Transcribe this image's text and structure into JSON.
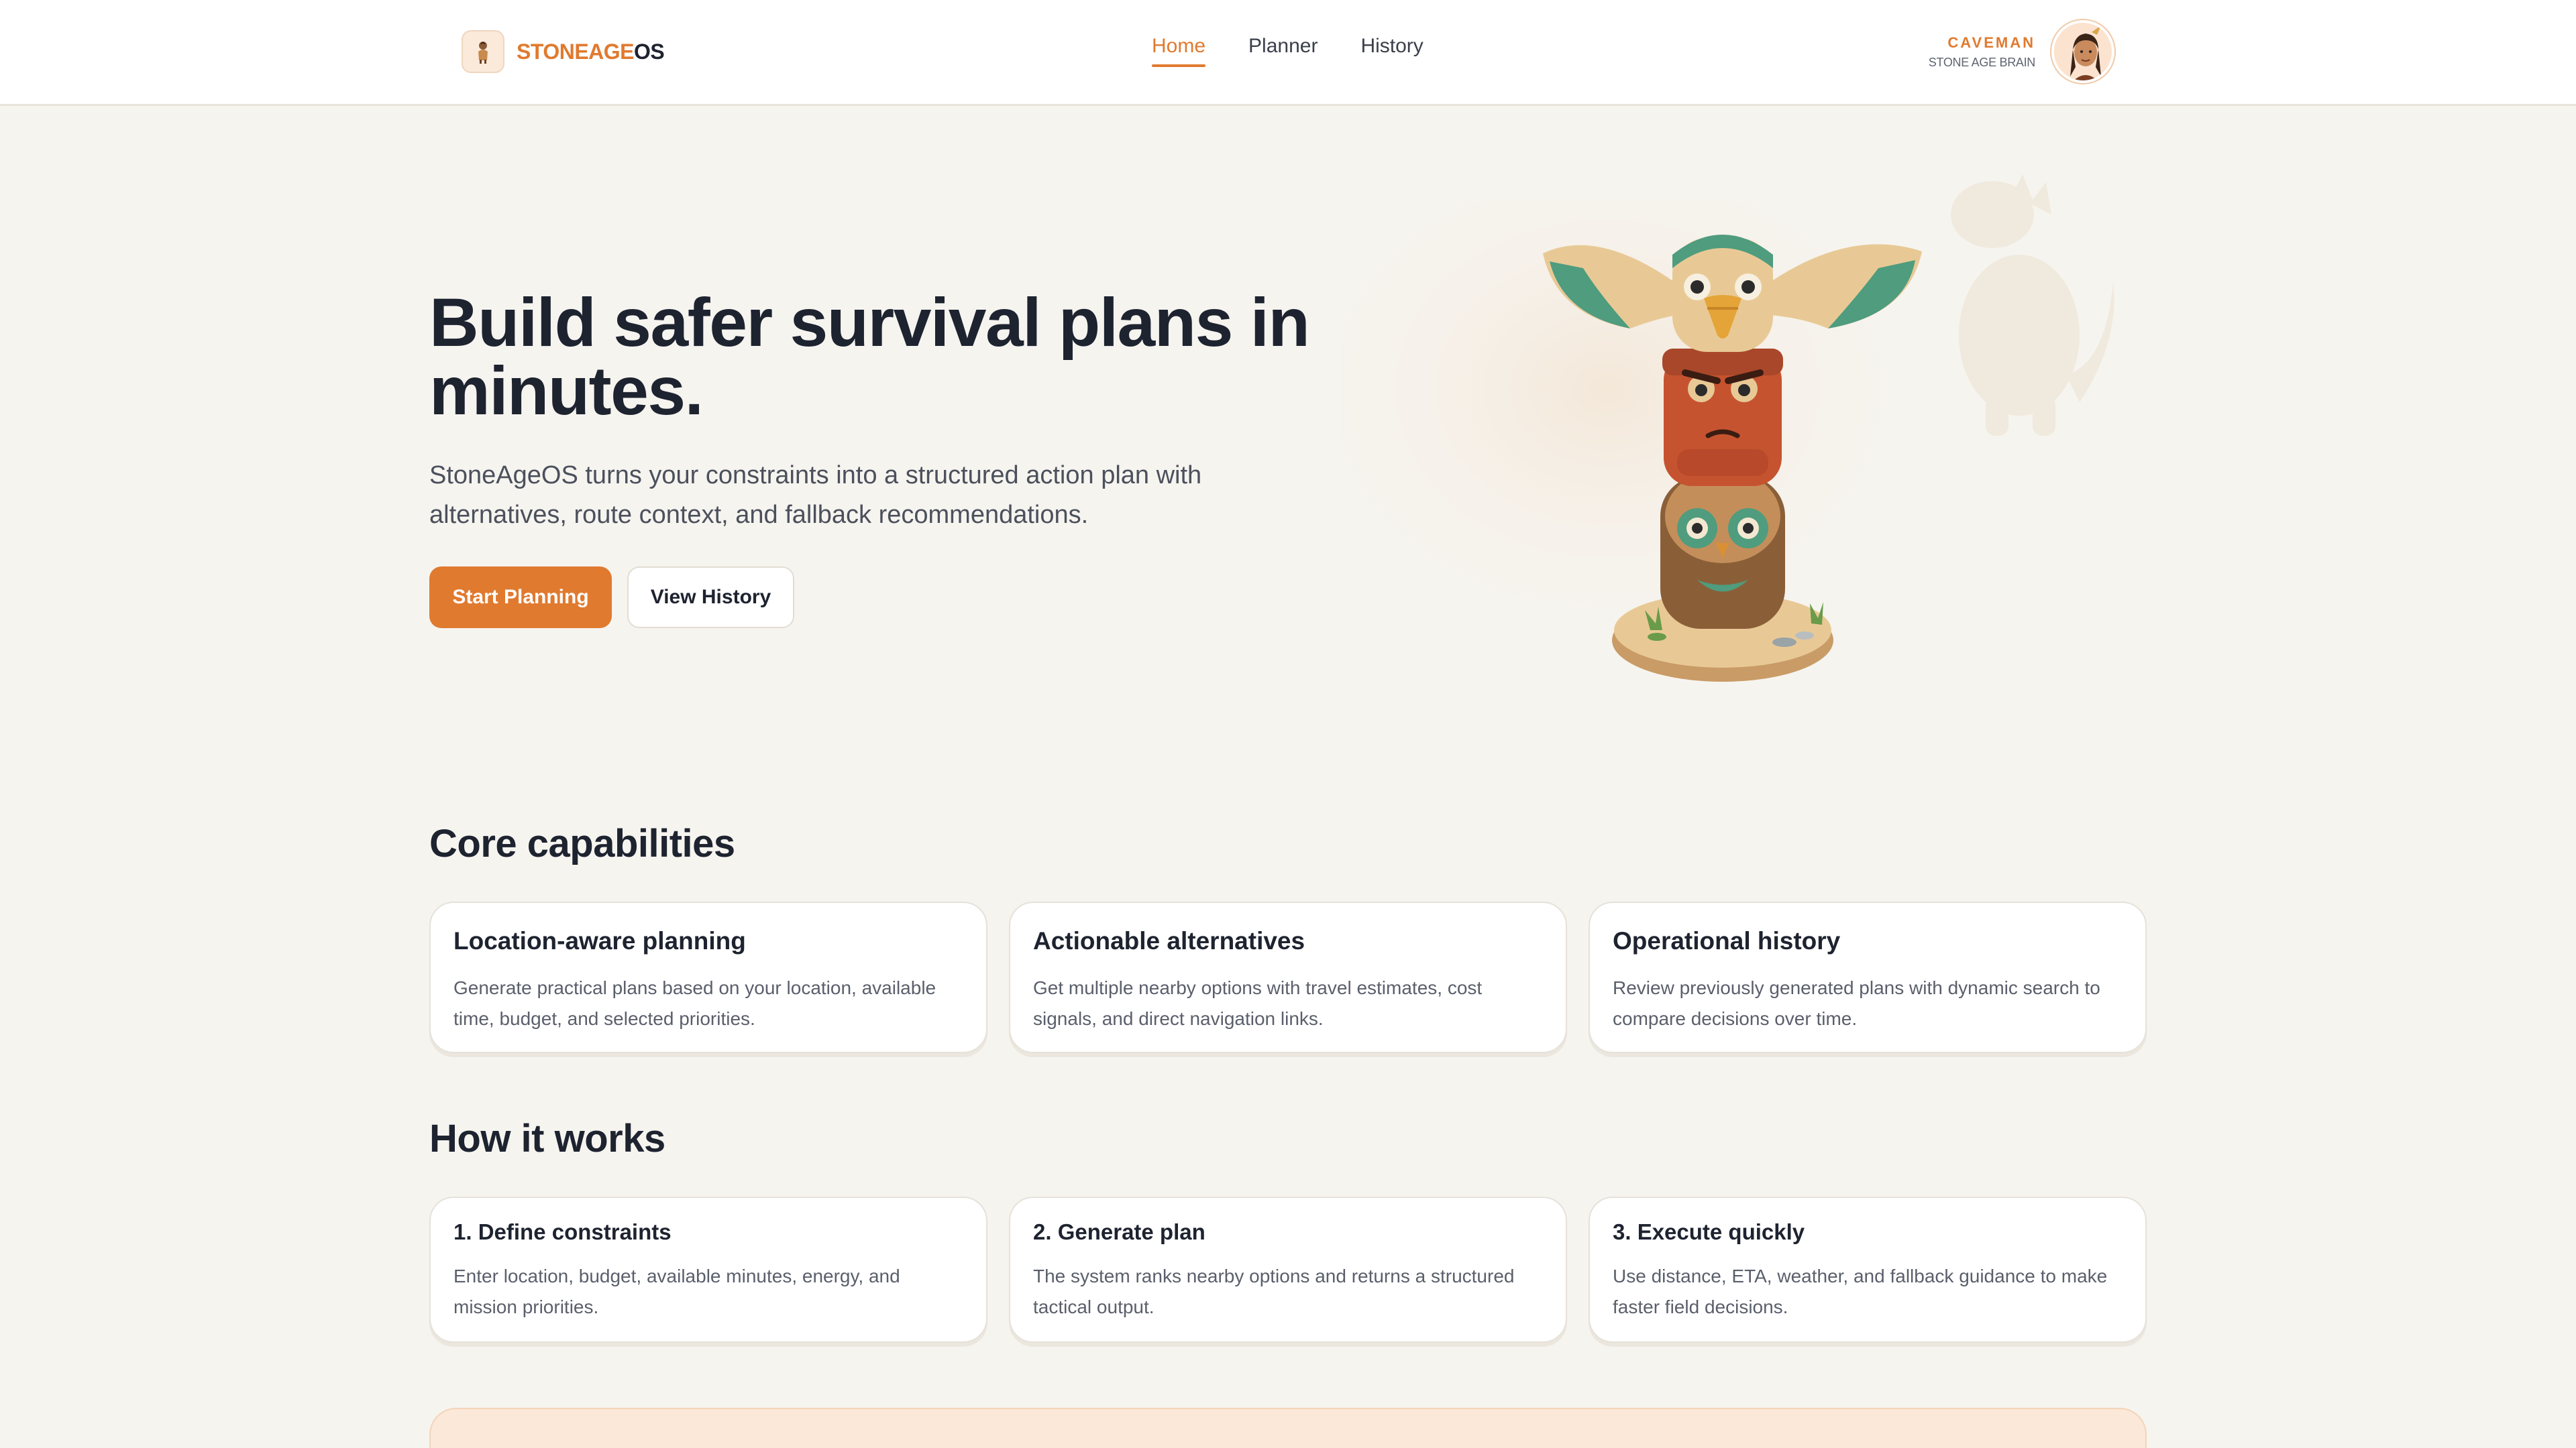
{
  "brand": {
    "name_part1": "STONEAGE",
    "name_part2": "OS",
    "logo_icon": "caveman-logo-icon",
    "accent": "#e07a2f"
  },
  "nav": {
    "items": [
      {
        "label": "Home",
        "active": true
      },
      {
        "label": "Planner",
        "active": false
      },
      {
        "label": "History",
        "active": false
      }
    ]
  },
  "user": {
    "name": "CAVEMAN",
    "role": "STONE AGE BRAIN",
    "avatar_icon": "caveman-avatar-icon"
  },
  "hero": {
    "title": "Build safer survival plans in minutes.",
    "subtitle": "StoneAgeOS turns your constraints into a structured action plan with alternatives, route context, and fallback recommendations.",
    "primary_cta": "Start Planning",
    "secondary_cta": "View History",
    "illustration": "totem-pole-illustration",
    "background_illustration": "dinosaur-illustration"
  },
  "capabilities": {
    "title": "Core capabilities",
    "cards": [
      {
        "title": "Location-aware planning",
        "desc": "Generate practical plans based on your location, available time, budget, and selected priorities."
      },
      {
        "title": "Actionable alternatives",
        "desc": "Get multiple nearby options with travel estimates, cost signals, and direct navigation links."
      },
      {
        "title": "Operational history",
        "desc": "Review previously generated plans with dynamic search to compare decisions over time."
      }
    ]
  },
  "how": {
    "title": "How it works",
    "steps": [
      {
        "title": "1. Define constraints",
        "desc": "Enter location, budget, available minutes, energy, and mission priorities."
      },
      {
        "title": "2. Generate plan",
        "desc": "The system ranks nearby options and returns a structured tactical output."
      },
      {
        "title": "3. Execute quickly",
        "desc": "Use distance, ETA, weather, and fallback guidance to make faster field decisions."
      }
    ]
  },
  "colors": {
    "accent": "#e07a2f",
    "background": "#f6f4ef",
    "text": "#1e2330",
    "muted": "#5a5f6b"
  }
}
